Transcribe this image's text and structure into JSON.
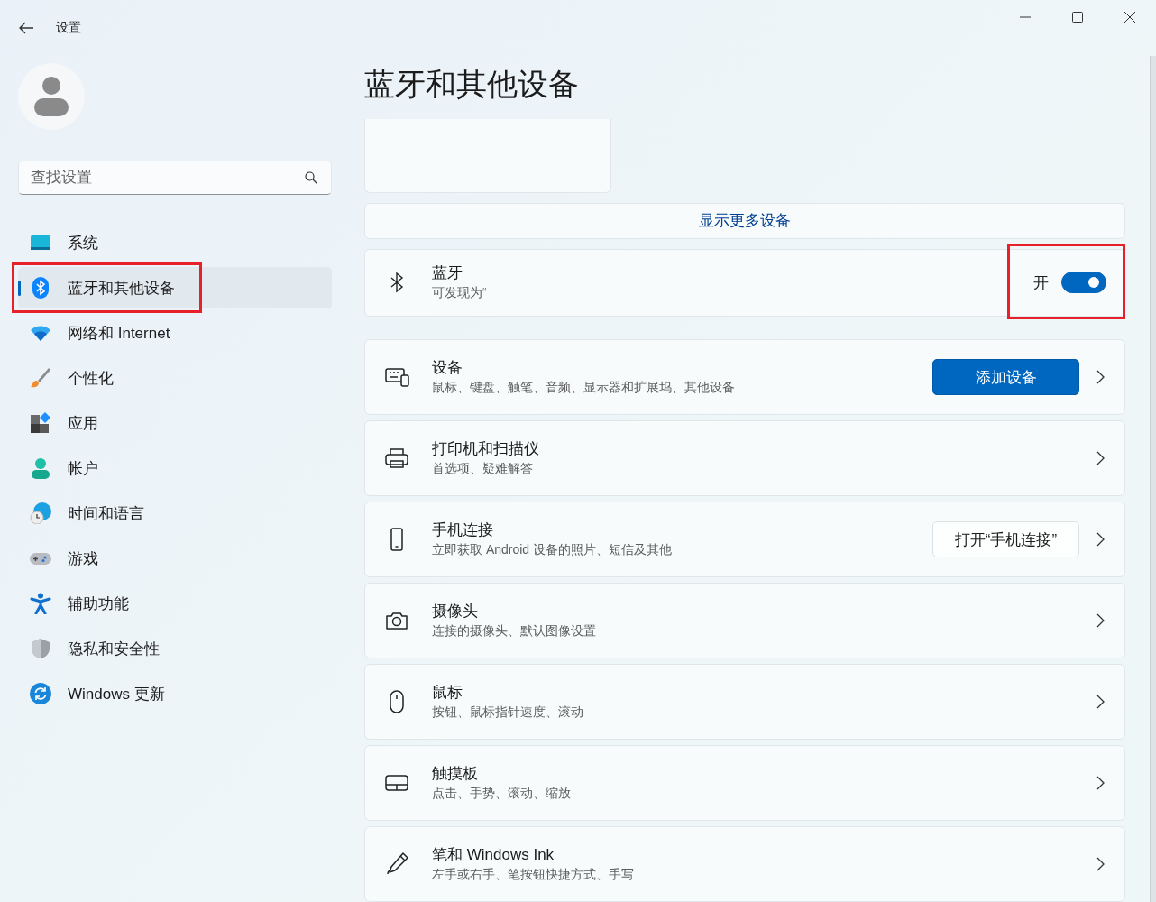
{
  "window": {
    "title": "设置"
  },
  "search": {
    "placeholder": "查找设置"
  },
  "sidebar": {
    "items": [
      {
        "label": "系统",
        "selected": false,
        "annotated": false
      },
      {
        "label": "蓝牙和其他设备",
        "selected": true,
        "annotated": true
      },
      {
        "label": "网络和 Internet",
        "selected": false,
        "annotated": false
      },
      {
        "label": "个性化",
        "selected": false,
        "annotated": false
      },
      {
        "label": "应用",
        "selected": false,
        "annotated": false
      },
      {
        "label": "帐户",
        "selected": false,
        "annotated": false
      },
      {
        "label": "时间和语言",
        "selected": false,
        "annotated": false
      },
      {
        "label": "游戏",
        "selected": false,
        "annotated": false
      },
      {
        "label": "辅助功能",
        "selected": false,
        "annotated": false
      },
      {
        "label": "隐私和安全性",
        "selected": false,
        "annotated": false
      },
      {
        "label": "Windows 更新",
        "selected": false,
        "annotated": false
      }
    ]
  },
  "page": {
    "title": "蓝牙和其他设备"
  },
  "show_more": {
    "label": "显示更多设备"
  },
  "bluetooth": {
    "title": "蓝牙",
    "subtitle": "可发现为“",
    "toggle_label": "开",
    "on": true,
    "annotated": true
  },
  "rows": [
    {
      "title": "设备",
      "subtitle": "鼠标、键盘、触笔、音频、显示器和扩展坞、其他设备",
      "action": {
        "label": "添加设备",
        "kind": "primary"
      }
    },
    {
      "title": "打印机和扫描仪",
      "subtitle": "首选项、疑难解答"
    },
    {
      "title": "手机连接",
      "subtitle": "立即获取 Android 设备的照片、短信及其他",
      "action": {
        "label": "打开“手机连接”",
        "kind": "secondary"
      }
    },
    {
      "title": "摄像头",
      "subtitle": "连接的摄像头、默认图像设置"
    },
    {
      "title": "鼠标",
      "subtitle": "按钮、鼠标指针速度、滚动"
    },
    {
      "title": "触摸板",
      "subtitle": "点击、手势、滚动、缩放"
    },
    {
      "title": "笔和 Windows Ink",
      "subtitle": "左手或右手、笔按钮快捷方式、手写"
    }
  ]
}
